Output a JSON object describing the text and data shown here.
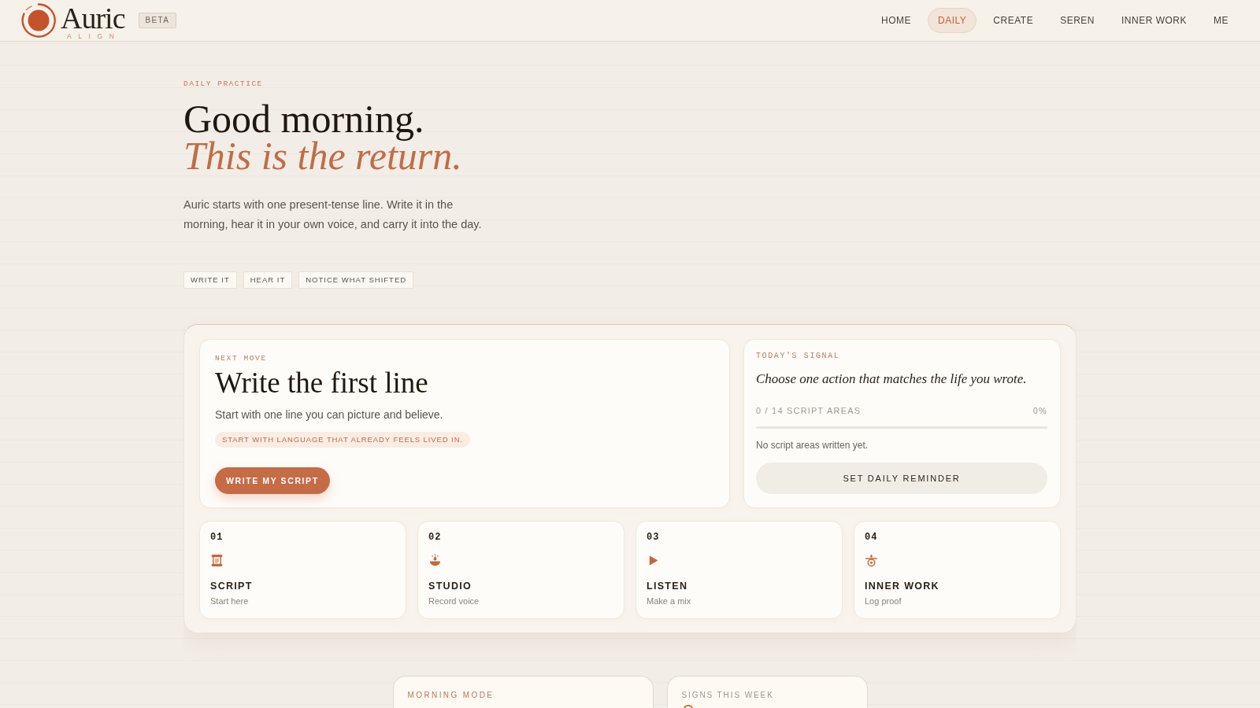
{
  "header": {
    "logo": {
      "wordmark": "Auric",
      "tagline": "ALIGN"
    },
    "badge": "BETA",
    "nav": [
      {
        "label": "HOME",
        "selected": false
      },
      {
        "label": "DAILY",
        "selected": true
      },
      {
        "label": "CREATE",
        "selected": false
      },
      {
        "label": "SEREN",
        "selected": false
      },
      {
        "label": "INNER WORK",
        "selected": false
      },
      {
        "label": "ME",
        "selected": false
      }
    ]
  },
  "hero": {
    "eyebrow": "DAILY PRACTICE",
    "title": "Good morning.",
    "subtitle": "This is the return.",
    "intro": "Auric starts with one present-tense line. Write it in the morning, hear it in your own voice, and carry it into the day.",
    "steps": [
      "WRITE IT",
      "HEAR IT",
      "NOTICE WHAT SHIFTED"
    ]
  },
  "next_move": {
    "eyebrow": "NEXT MOVE",
    "title": "Write the first line",
    "text": "Start with one line you can picture and believe.",
    "hint": "START WITH LANGUAGE THAT ALREADY FEELS LIVED IN.",
    "button": "WRITE MY SCRIPT"
  },
  "signal": {
    "eyebrow": "TODAY'S SIGNAL",
    "prompt": "Choose one action that matches the life you wrote.",
    "progress_label": "0 / 14 SCRIPT AREAS",
    "progress_reading": "0%",
    "level": 0,
    "note": "No script areas written yet.",
    "button": "SET DAILY REMINDER"
  },
  "tools": [
    {
      "number": "01",
      "title": "SCRIPT",
      "subtitle": "Start here"
    },
    {
      "number": "02",
      "title": "STUDIO",
      "subtitle": "Record voice"
    },
    {
      "number": "03",
      "title": "LISTEN",
      "subtitle": "Make a mix"
    },
    {
      "number": "04",
      "title": "INNER WORK",
      "subtitle": "Log proof"
    }
  ],
  "morning_mode": {
    "eyebrow": "MORNING MODE"
  },
  "signs": {
    "eyebrow": "SIGNS THIS WEEK"
  }
}
